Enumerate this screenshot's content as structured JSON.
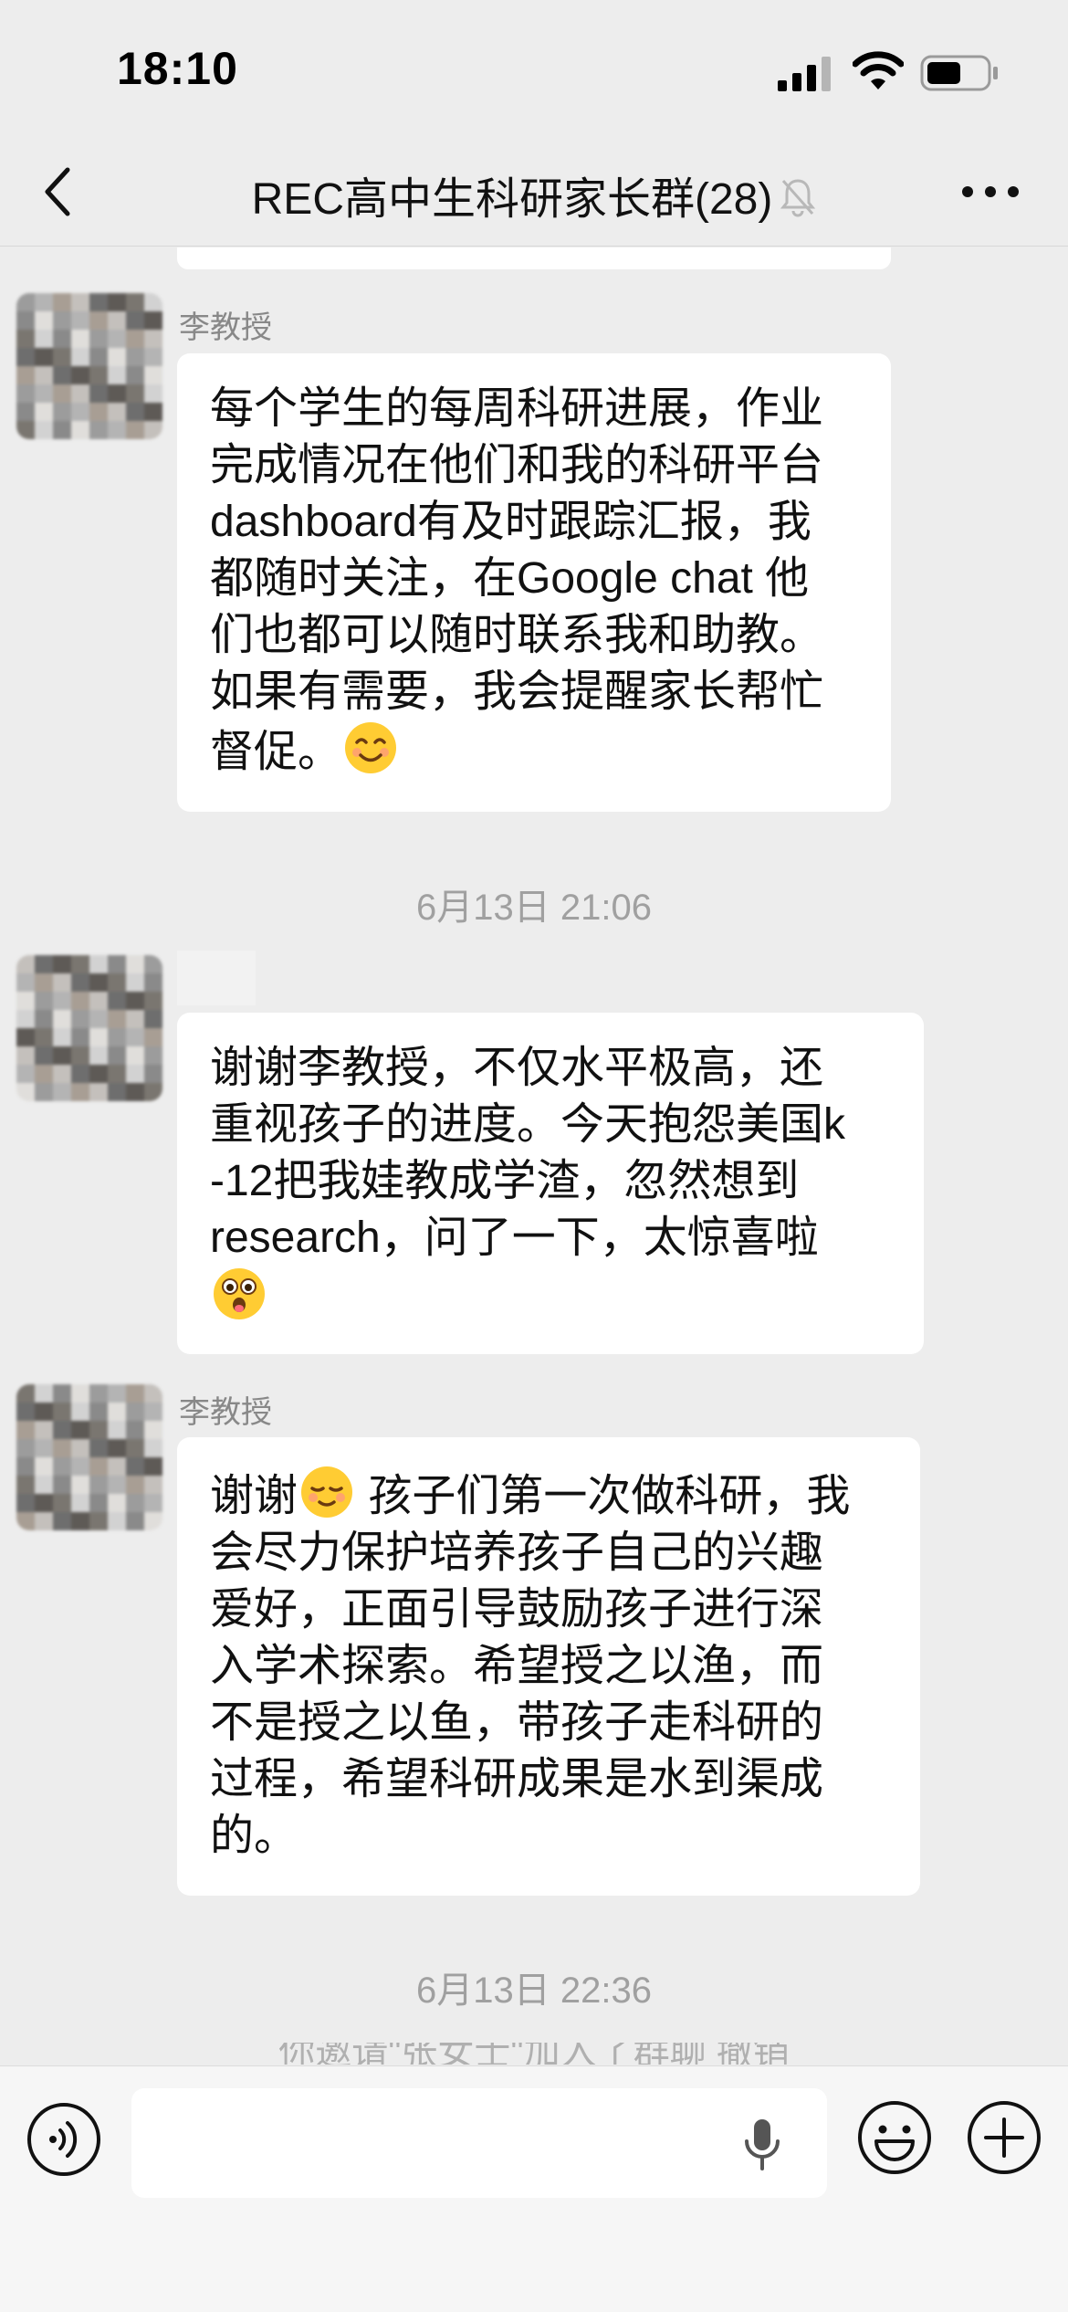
{
  "status_bar": {
    "time": "18:10"
  },
  "header": {
    "title": "REC高中生科研家长群(28)"
  },
  "messages": [
    {
      "sender": "李教授",
      "lines": [
        "每个学生的每周科研进展，作业",
        "完成情况在他们和我的科研平台",
        "dashboard有及时跟踪汇报，我",
        "都随时关注，在Google chat 他",
        "们也都可以随时联系我和助教。",
        "如果有需要，我会提醒家长帮忙",
        "督促。"
      ]
    },
    {
      "lines": [
        "谢谢李教授，不仅水平极高，还",
        "重视孩子的进度。今天抱怨美国k",
        "-12把我娃教成学渣，忽然想到",
        "research，问了一下，太惊喜啦",
        ""
      ]
    },
    {
      "sender": "李教授",
      "lines": [
        "谢谢",
        "会尽力保护培养孩子自己的兴趣",
        "爱好，正面引导鼓励孩子进行深",
        "入学术探索。希望授之以渔，而",
        "不是授之以鱼，带孩子走科研的",
        "过程，希望科研成果是水到渠成",
        "的。"
      ],
      "first_line_rest": "孩子们第一次做科研，我"
    }
  ],
  "timestamps": [
    "6月13日 21:06",
    "6月13日 22:36"
  ],
  "system_notice_partial": "你邀请\"张女士\"加入了群聊  撤销",
  "input": {
    "value": "",
    "placeholder": ""
  },
  "icons": {
    "back": "chevron-left-icon",
    "mute": "bell-slash-icon",
    "more": "more-dots-icon",
    "voice": "voice-wave-icon",
    "mic": "microphone-icon",
    "emoji": "smiley-face-icon",
    "plus": "plus-circle-icon"
  },
  "colors": {
    "background": "#ededed",
    "bubble": "#ffffff",
    "timestamp": "#a0a0a0",
    "sender": "#888888"
  }
}
